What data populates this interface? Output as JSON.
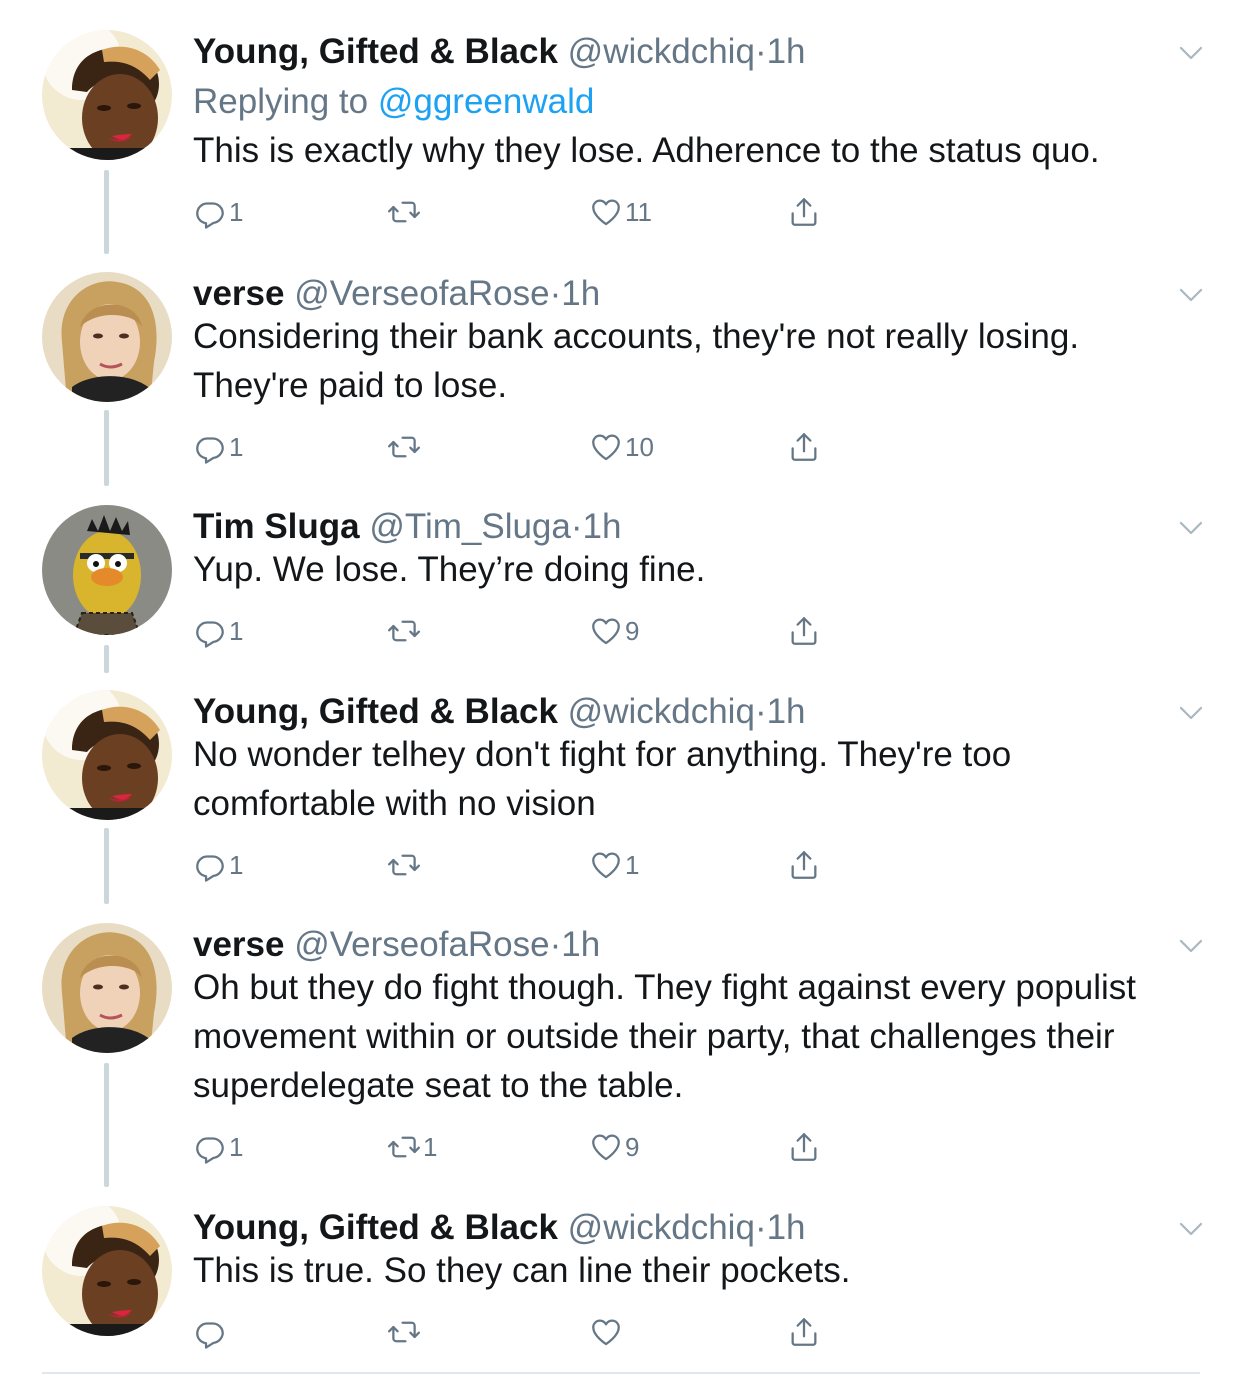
{
  "colors": {
    "text": "#14171a",
    "secondary": "#657786",
    "link": "#1da1f2",
    "thread_line": "#ccd6dd",
    "divider": "#e1e8ed"
  },
  "tweets": [
    {
      "name": "Young, Gifted & Black",
      "handle": "@wickdchiq",
      "dot": "·",
      "time": "1h",
      "replying_prefix": "Replying to",
      "replying_to": "@ggreenwald",
      "text": "This is exactly why they lose. Adherence to the status quo.",
      "replies": "1",
      "retweets": "",
      "likes": "11",
      "avatar": "avatar-young-gifted-black"
    },
    {
      "name": "verse",
      "handle": "@VerseofaRose",
      "dot": "·",
      "time": "1h",
      "text": "Considering their bank accounts, they're not really losing. They're paid to lose.",
      "replies": "1",
      "retweets": "",
      "likes": "10",
      "avatar": "avatar-verse"
    },
    {
      "name": "Tim Sluga",
      "handle": "@Tim_Sluga",
      "dot": "·",
      "time": "1h",
      "text": "Yup. We lose. They’re doing fine.",
      "replies": "1",
      "retweets": "",
      "likes": "9",
      "avatar": "avatar-tim-sluga"
    },
    {
      "name": "Young, Gifted & Black",
      "handle": "@wickdchiq",
      "dot": "·",
      "time": "1h",
      "text": "No wonder telhey don't fight for anything. They're too comfortable with no vision",
      "replies": "1",
      "retweets": "",
      "likes": "1",
      "avatar": "avatar-young-gifted-black"
    },
    {
      "name": "verse",
      "handle": "@VerseofaRose",
      "dot": "·",
      "time": "1h",
      "text": "Oh but they do fight though. They fight against every populist movement within or outside their party, that challenges their superdelegate seat to the table.",
      "replies": "1",
      "retweets": "1",
      "likes": "9",
      "avatar": "avatar-verse"
    },
    {
      "name": "Young, Gifted & Black",
      "handle": "@wickdchiq",
      "dot": "·",
      "time": "1h",
      "text": "This is true. So they can line their pockets.",
      "replies": "",
      "retweets": "",
      "likes": "",
      "avatar": "avatar-young-gifted-black"
    }
  ]
}
